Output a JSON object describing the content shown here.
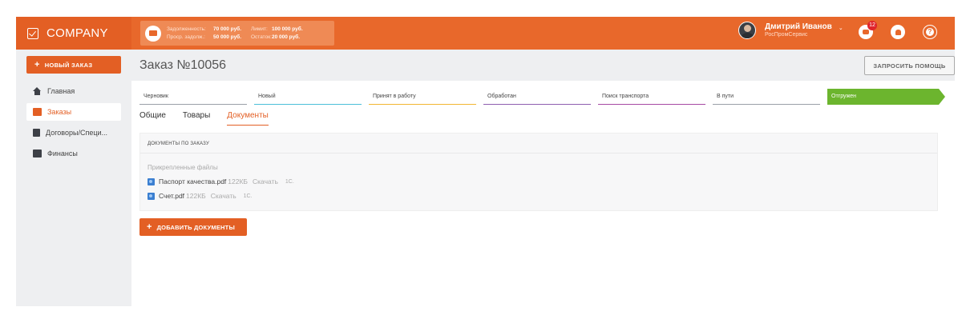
{
  "brand": {
    "name": "COMPANY"
  },
  "debt": {
    "debt_label": "Задолженность:",
    "debt_value": "70 000 руб.",
    "limit_label": "Лимит:",
    "limit_value": "100 000 руб.",
    "overdue_label": "Проср. задолж.:",
    "overdue_value": "50 000 руб.",
    "balance_label": "Остаток:",
    "balance_value": "20 000 руб."
  },
  "user": {
    "name": "Дмитрий Иванов",
    "org": "РосПромСервис",
    "caret": "⌄"
  },
  "notifications": {
    "chat_count": "12"
  },
  "help_icon_text": "?",
  "sidebar": {
    "new_order_label": "НОВЫЙ ЗАКАЗ",
    "items": [
      {
        "label": "Главная",
        "icon": "home-icon"
      },
      {
        "label": "Заказы",
        "icon": "box-icon"
      },
      {
        "label": "Договоры/Специ...",
        "icon": "document-icon"
      },
      {
        "label": "Финансы",
        "icon": "card-icon"
      }
    ],
    "active_index": 1
  },
  "page": {
    "title": "Заказ №10056",
    "help_button": "ЗАПРОСИТЬ ПОМОЩЬ"
  },
  "status_steps": [
    {
      "label": "Черновик",
      "color": "#9aa0a8"
    },
    {
      "label": "Новый",
      "color": "#4cc0d8"
    },
    {
      "label": "Принят в работу",
      "color": "#f2b632"
    },
    {
      "label": "Обработан",
      "color": "#8e5fb0"
    },
    {
      "label": "Поиск транспорта",
      "color": "#a64aa3"
    },
    {
      "label": "В пути",
      "color": "#9aa0a8"
    },
    {
      "label": "Отгружен",
      "color": "#6cb52e"
    }
  ],
  "tabs": [
    {
      "label": "Общие"
    },
    {
      "label": "Товары"
    },
    {
      "label": "Документы"
    }
  ],
  "active_tab": 2,
  "documents": {
    "header": "ДОКУМЕНТЫ ПО ЗАКАЗУ",
    "attached_label": "Прикрепленные файлы",
    "files": [
      {
        "name": "Паспорт качества.pdf",
        "size": "122КБ",
        "download": "Скачать",
        "onec": "1С."
      },
      {
        "name": "Счет.pdf",
        "size": "122КБ",
        "download": "Скачать",
        "onec": "1С."
      }
    ],
    "add_button": "ДОБАВИТЬ ДОКУМЕНТЫ"
  }
}
